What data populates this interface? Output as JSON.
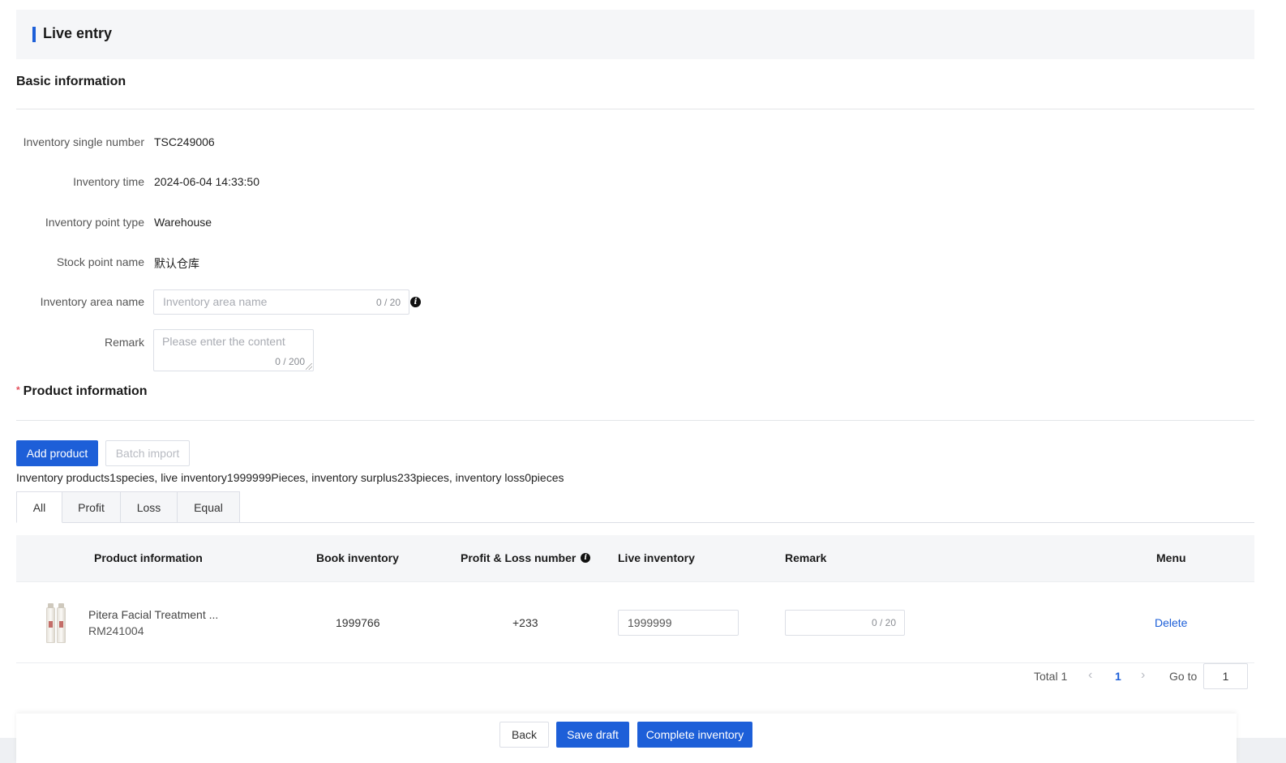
{
  "header": {
    "title": "Live entry"
  },
  "basic_info": {
    "section_title": "Basic information",
    "fields": {
      "inventory_single_number": {
        "label": "Inventory single number",
        "value": "TSC249006"
      },
      "inventory_time": {
        "label": "Inventory time",
        "value": "2024-06-04 14:33:50"
      },
      "inventory_point_type": {
        "label": "Inventory point type",
        "value": "Warehouse"
      },
      "stock_point_name": {
        "label": "Stock point name",
        "value": "默认仓库"
      },
      "inventory_area_name": {
        "label": "Inventory area name",
        "placeholder": "Inventory area name",
        "counter": "0 / 20"
      },
      "remark": {
        "label": "Remark",
        "placeholder": "Please enter the content",
        "counter": "0 / 200"
      }
    }
  },
  "product_info": {
    "required_mark": "*",
    "section_title": "Product information",
    "add_product_label": "Add product",
    "batch_import_label": "Batch import",
    "summary": "Inventory products1species, live inventory1999999Pieces, inventory surplus233pieces, inventory loss0pieces",
    "tabs": [
      {
        "label": "All",
        "active": true
      },
      {
        "label": "Profit",
        "active": false
      },
      {
        "label": "Loss",
        "active": false
      },
      {
        "label": "Equal",
        "active": false
      }
    ],
    "table": {
      "columns": [
        "Product information",
        "Book inventory",
        "Profit & Loss number",
        "Live inventory",
        "Remark",
        "Menu"
      ],
      "rows": [
        {
          "product_name": "Pitera Facial Treatment ...",
          "product_code": "RM241004",
          "book_inventory": "1999766",
          "profit_loss": "+233",
          "live_inventory": "1999999",
          "remark_counter": "0 / 20",
          "action": "Delete"
        }
      ]
    },
    "pagination": {
      "total_label": "Total 1",
      "prev_icon": "chevron-left-icon",
      "current_page": "1",
      "next_icon": "chevron-right-icon",
      "goto_label": "Go to",
      "goto_value": "1"
    }
  },
  "footer": {
    "back_label": "Back",
    "save_draft_label": "Save draft",
    "complete_label": "Complete inventory"
  },
  "colors": {
    "primary": "#1d5fd8",
    "danger": "#e34d59",
    "header_bg": "#f5f6f8"
  }
}
